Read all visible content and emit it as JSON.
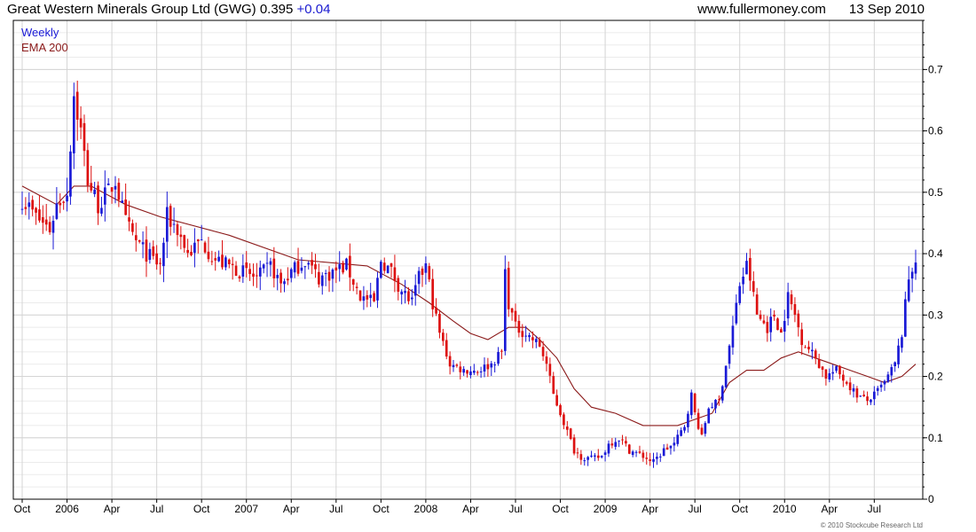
{
  "header": {
    "title": "Great Western Minerals Group Ltd (GWG)",
    "price": "0.395",
    "change": "+0.04",
    "website": "www.fullermoney.com",
    "date": "13 Sep 2010"
  },
  "copyright": "© 2010 Stockcube Research Ltd",
  "colors": {
    "up": "#1a1ad6",
    "down": "#dd1111",
    "ema": "#8b1a1a",
    "grid": "#d4d4d4",
    "frame": "#000000"
  },
  "chart_data": {
    "type": "candlestick",
    "title": "Great Western Minerals Group Ltd (GWG)",
    "legend": [
      "Weekly",
      "EMA 200"
    ],
    "legend_placement": "top-left",
    "grid": true,
    "y_axis_side": "right",
    "ylim": [
      0,
      0.78
    ],
    "y_ticks": [
      0,
      0.1,
      0.2,
      0.3,
      0.4,
      0.5,
      0.6,
      0.7
    ],
    "x_ticks": [
      "Oct",
      "2006",
      "Apr",
      "Jul",
      "Oct",
      "2007",
      "Apr",
      "Jul",
      "Oct",
      "2008",
      "Apr",
      "Jul",
      "Oct",
      "2009",
      "Apr",
      "Jul",
      "Oct",
      "2010",
      "Apr",
      "Jul"
    ],
    "x_range_weeks": [
      0,
      259
    ],
    "x_tick_weeks": [
      0,
      13,
      26,
      39,
      52,
      65,
      78,
      91,
      104,
      117,
      130,
      143,
      156,
      169,
      182,
      195,
      208,
      221,
      234,
      247
    ],
    "price_path": [
      [
        0,
        0.49
      ],
      [
        4,
        0.46
      ],
      [
        8,
        0.44
      ],
      [
        10,
        0.48
      ],
      [
        13,
        0.5
      ],
      [
        15,
        0.66
      ],
      [
        17,
        0.6
      ],
      [
        19,
        0.52
      ],
      [
        22,
        0.48
      ],
      [
        25,
        0.5
      ],
      [
        27,
        0.52
      ],
      [
        30,
        0.45
      ],
      [
        33,
        0.42
      ],
      [
        36,
        0.4
      ],
      [
        40,
        0.38
      ],
      [
        42,
        0.46
      ],
      [
        45,
        0.44
      ],
      [
        48,
        0.4
      ],
      [
        52,
        0.42
      ],
      [
        56,
        0.39
      ],
      [
        60,
        0.38
      ],
      [
        64,
        0.37
      ],
      [
        68,
        0.36
      ],
      [
        72,
        0.38
      ],
      [
        75,
        0.35
      ],
      [
        78,
        0.37
      ],
      [
        82,
        0.39
      ],
      [
        86,
        0.36
      ],
      [
        90,
        0.37
      ],
      [
        94,
        0.38
      ],
      [
        98,
        0.33
      ],
      [
        102,
        0.32
      ],
      [
        104,
        0.39
      ],
      [
        107,
        0.37
      ],
      [
        110,
        0.34
      ],
      [
        113,
        0.32
      ],
      [
        115,
        0.36
      ],
      [
        117,
        0.38
      ],
      [
        119,
        0.32
      ],
      [
        121,
        0.27
      ],
      [
        124,
        0.22
      ],
      [
        128,
        0.21
      ],
      [
        132,
        0.21
      ],
      [
        136,
        0.22
      ],
      [
        139,
        0.24
      ],
      [
        140,
        0.37
      ],
      [
        141,
        0.32
      ],
      [
        143,
        0.28
      ],
      [
        146,
        0.27
      ],
      [
        150,
        0.25
      ],
      [
        152,
        0.22
      ],
      [
        154,
        0.17
      ],
      [
        156,
        0.14
      ],
      [
        158,
        0.11
      ],
      [
        160,
        0.08
      ],
      [
        162,
        0.07
      ],
      [
        165,
        0.065
      ],
      [
        168,
        0.07
      ],
      [
        170,
        0.09
      ],
      [
        173,
        0.1
      ],
      [
        176,
        0.08
      ],
      [
        180,
        0.07
      ],
      [
        183,
        0.06
      ],
      [
        186,
        0.08
      ],
      [
        189,
        0.09
      ],
      [
        192,
        0.12
      ],
      [
        194,
        0.17
      ],
      [
        195,
        0.14
      ],
      [
        197,
        0.1
      ],
      [
        199,
        0.15
      ],
      [
        202,
        0.16
      ],
      [
        204,
        0.22
      ],
      [
        206,
        0.28
      ],
      [
        208,
        0.35
      ],
      [
        210,
        0.38
      ],
      [
        211,
        0.36
      ],
      [
        213,
        0.3
      ],
      [
        216,
        0.28
      ],
      [
        218,
        0.3
      ],
      [
        220,
        0.27
      ],
      [
        222,
        0.33
      ],
      [
        224,
        0.3
      ],
      [
        226,
        0.26
      ],
      [
        230,
        0.23
      ],
      [
        233,
        0.2
      ],
      [
        236,
        0.21
      ],
      [
        239,
        0.19
      ],
      [
        242,
        0.17
      ],
      [
        245,
        0.16
      ],
      [
        247,
        0.17
      ],
      [
        250,
        0.19
      ],
      [
        253,
        0.22
      ],
      [
        255,
        0.27
      ],
      [
        257,
        0.36
      ],
      [
        259,
        0.395
      ]
    ],
    "ema_200": [
      [
        0,
        0.51
      ],
      [
        10,
        0.48
      ],
      [
        15,
        0.51
      ],
      [
        20,
        0.51
      ],
      [
        30,
        0.48
      ],
      [
        40,
        0.46
      ],
      [
        60,
        0.43
      ],
      [
        80,
        0.39
      ],
      [
        100,
        0.38
      ],
      [
        110,
        0.35
      ],
      [
        118,
        0.32
      ],
      [
        125,
        0.29
      ],
      [
        130,
        0.27
      ],
      [
        135,
        0.26
      ],
      [
        141,
        0.28
      ],
      [
        146,
        0.28
      ],
      [
        150,
        0.26
      ],
      [
        155,
        0.23
      ],
      [
        160,
        0.18
      ],
      [
        165,
        0.15
      ],
      [
        172,
        0.14
      ],
      [
        180,
        0.12
      ],
      [
        186,
        0.12
      ],
      [
        190,
        0.12
      ],
      [
        195,
        0.13
      ],
      [
        200,
        0.14
      ],
      [
        205,
        0.19
      ],
      [
        210,
        0.21
      ],
      [
        215,
        0.21
      ],
      [
        220,
        0.23
      ],
      [
        225,
        0.24
      ],
      [
        230,
        0.23
      ],
      [
        235,
        0.22
      ],
      [
        240,
        0.21
      ],
      [
        245,
        0.2
      ],
      [
        250,
        0.19
      ],
      [
        255,
        0.2
      ],
      [
        259,
        0.22
      ]
    ]
  }
}
